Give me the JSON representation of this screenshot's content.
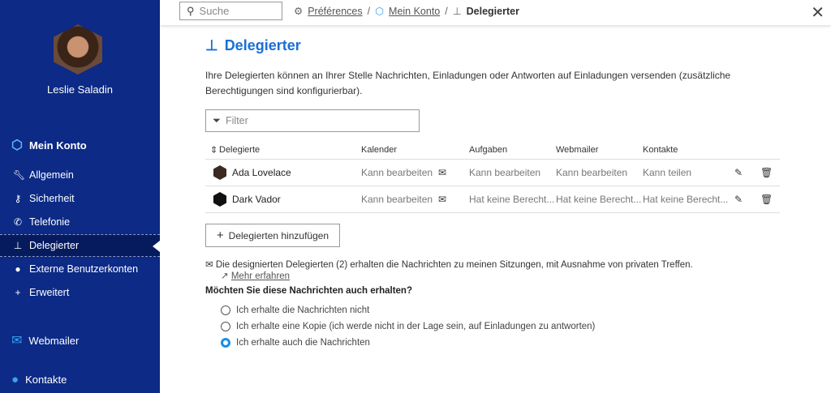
{
  "sidebar": {
    "user_name": "Leslie Saladin",
    "section_account": "Mein Konto",
    "items": [
      {
        "label": "Allgemein",
        "icon": "wrench-icon"
      },
      {
        "label": "Sicherheit",
        "icon": "key-icon"
      },
      {
        "label": "Telefonie",
        "icon": "phone-icon"
      },
      {
        "label": "Delegierter",
        "icon": "org-chart-icon"
      },
      {
        "label": "Externe Benutzerkonten",
        "icon": "user-icon"
      },
      {
        "label": "Erweitert",
        "icon": "plus-icon"
      }
    ],
    "active": "Delegierter",
    "section_mail": "Webmailer",
    "section_contacts": "Kontakte"
  },
  "topbar": {
    "search_placeholder": "Suche",
    "breadcrumb": [
      "Préférences",
      "Mein Konto",
      "Delegierter"
    ]
  },
  "page": {
    "title": "Delegierter",
    "description": "Ihre Delegierten können an Ihrer Stelle Nachrichten, Einladungen oder Antworten auf Einladungen versenden (zusätzliche Berechtigungen sind konfigurierbar).",
    "filter_placeholder": "Filter"
  },
  "table": {
    "headers": [
      "Delegierte",
      "Kalender",
      "Aufgaben",
      "Webmailer",
      "Kontakte"
    ],
    "rows": [
      {
        "name": "Ada Lovelace",
        "kalender": "Kann bearbeiten",
        "aufgaben": "Kann bearbeiten",
        "webmailer": "Kann bearbeiten",
        "kontakte": "Kann teilen"
      },
      {
        "name": "Dark Vador",
        "kalender": "Kann bearbeiten",
        "aufgaben": "Hat keine Berecht...",
        "webmailer": "Hat keine Berecht...",
        "kontakte": "Hat keine Berecht..."
      }
    ]
  },
  "add_button": "Delegierten hinzufügen",
  "info": {
    "text": "Die designierten Delegierten (2) erhalten die Nachrichten zu meinen Sitzungen, mit Ausnahme von privaten Treffen.",
    "link": "Mehr erfahren"
  },
  "question": "Möchten Sie diese Nachrichten auch erhalten?",
  "options": [
    {
      "label": "Ich erhalte die Nachrichten nicht",
      "selected": false
    },
    {
      "label": "Ich erhalte eine Kopie (ich werde nicht in der Lage sein, auf Einladungen zu antworten)",
      "selected": false
    },
    {
      "label": "Ich erhalte auch die Nachrichten",
      "selected": true
    }
  ],
  "colors": {
    "sidebar": "#0c2a86",
    "accent": "#1a6fd6"
  }
}
